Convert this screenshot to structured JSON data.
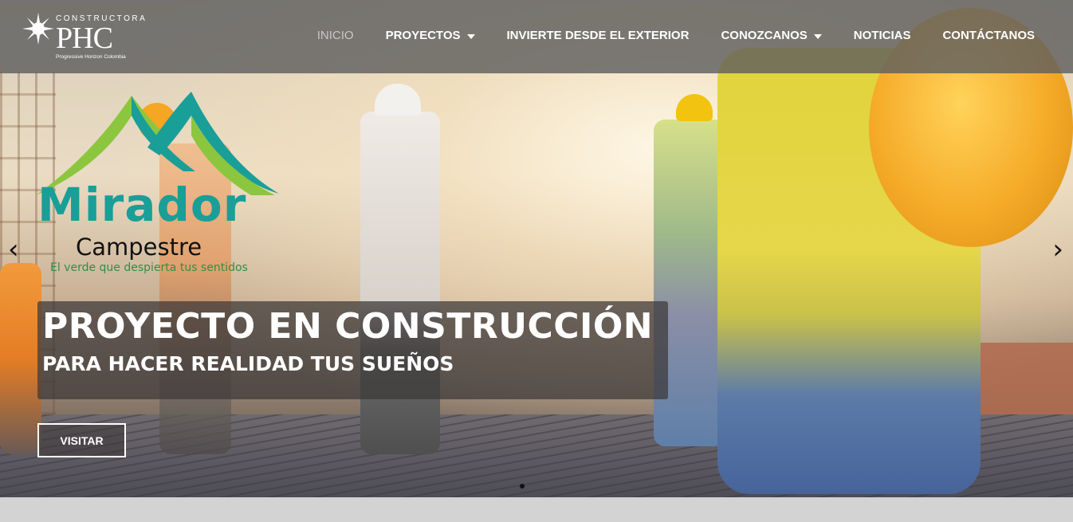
{
  "logo": {
    "top_text": "CONSTRUCTORA",
    "main_text": "PHC",
    "sub_text": "Progressive Horizon Colombia"
  },
  "nav": {
    "items": [
      {
        "label": "INICIO",
        "active": true,
        "dropdown": false
      },
      {
        "label": "PROYECTOS",
        "active": false,
        "dropdown": true
      },
      {
        "label": "INVIERTE DESDE EL EXTERIOR",
        "active": false,
        "dropdown": false
      },
      {
        "label": "CONOZCANOS",
        "active": false,
        "dropdown": true
      },
      {
        "label": "NOTICIAS",
        "active": false,
        "dropdown": false
      },
      {
        "label": "CONTÁCTANOS",
        "active": false,
        "dropdown": false
      }
    ]
  },
  "project_logo": {
    "name": "Mirador",
    "subtitle": "Campestre",
    "tagline": "El verde que despierta tus sentidos"
  },
  "slide": {
    "title": "PROYECTO EN CONSTRUCCIÓN",
    "subtitle": "PARA HACER REALIDAD TUS SUEÑOS",
    "button_label": "VISITAR",
    "prev_arrow": "‹",
    "next_arrow": "›"
  },
  "colors": {
    "header_bg": "#5f5f5f",
    "brand_teal": "#1a9e98",
    "brand_green": "#8cc63f",
    "brand_orange": "#f5a623"
  }
}
